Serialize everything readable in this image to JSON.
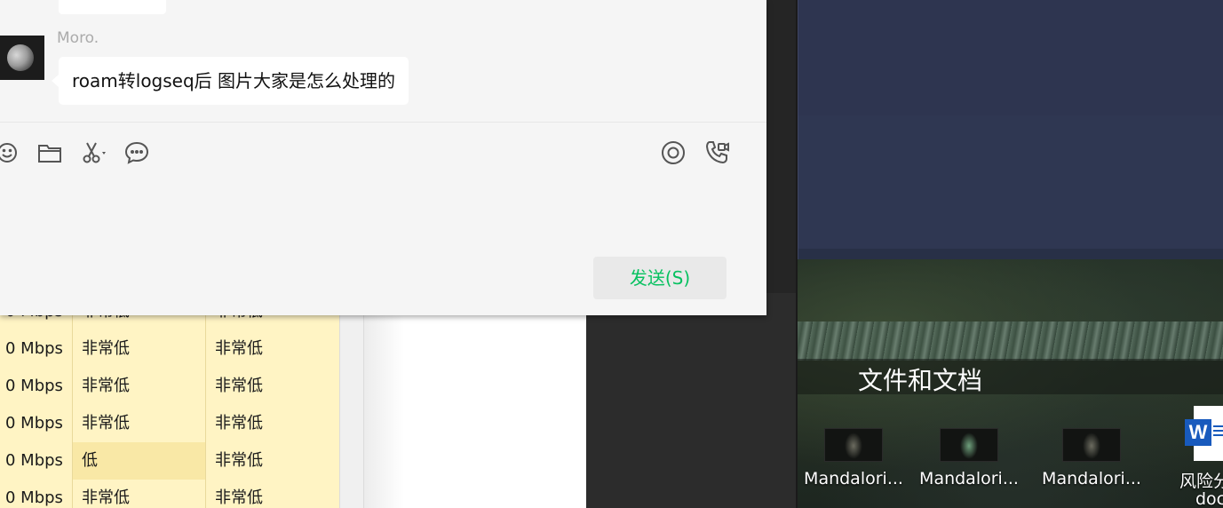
{
  "chat": {
    "sender_name": "Moro.",
    "message_text": "roam转logseq后 图片大家是怎么处理的",
    "send_button_label": "发送(S)",
    "toolbar_icons": [
      "emoji-icon",
      "folder-icon",
      "scissors-icon",
      "chat-bubble-icon"
    ],
    "toolbar_right_icons": [
      "live-icon",
      "video-call-icon"
    ],
    "accent_color": "#07c160"
  },
  "task_manager": {
    "partial_row": {
      "c1": "0 Mbps",
      "c2": "非常低",
      "c3": "非常低"
    },
    "rows": [
      {
        "c1": "0 Mbps",
        "c2": "非常低",
        "c3": "非常低"
      },
      {
        "c1": "0 Mbps",
        "c2": "非常低",
        "c3": "非常低"
      },
      {
        "c1": "0 Mbps",
        "c2": "非常低",
        "c3": "非常低"
      },
      {
        "c1": "0 Mbps",
        "c2": "低",
        "c3": "非常低"
      },
      {
        "c1": "0 Mbps",
        "c2": "非常低",
        "c3": "非常低"
      }
    ]
  },
  "desktop": {
    "group_title": "文件和文档",
    "files": [
      {
        "label": "Mandalori..."
      },
      {
        "label": "Mandalori..."
      },
      {
        "label": "Mandalori..."
      }
    ],
    "word_file": {
      "label_line1": "风险分",
      "label_line2": "doc"
    }
  }
}
